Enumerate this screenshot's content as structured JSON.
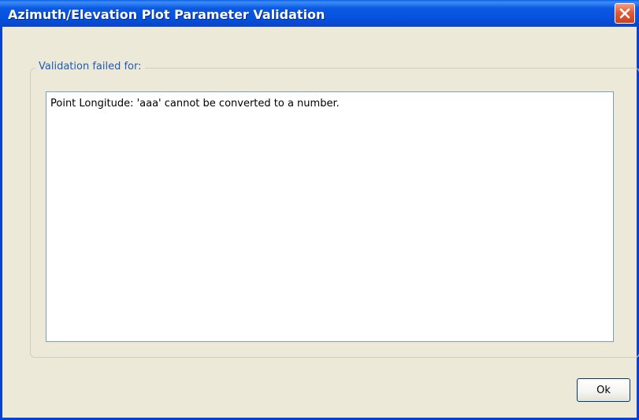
{
  "window": {
    "title": "Azimuth/Elevation Plot Parameter Validation"
  },
  "group": {
    "label": "Validation failed for:"
  },
  "details": {
    "value": "Point Longitude: 'aaa' cannot be converted to a number."
  },
  "buttons": {
    "ok_label": "Ok"
  },
  "icons": {
    "close": "close-icon"
  },
  "colors": {
    "titlebar": "#0650dc",
    "close_button": "#e35c36",
    "window_background": "#ece9d8",
    "group_label": "#1f5bb4"
  }
}
